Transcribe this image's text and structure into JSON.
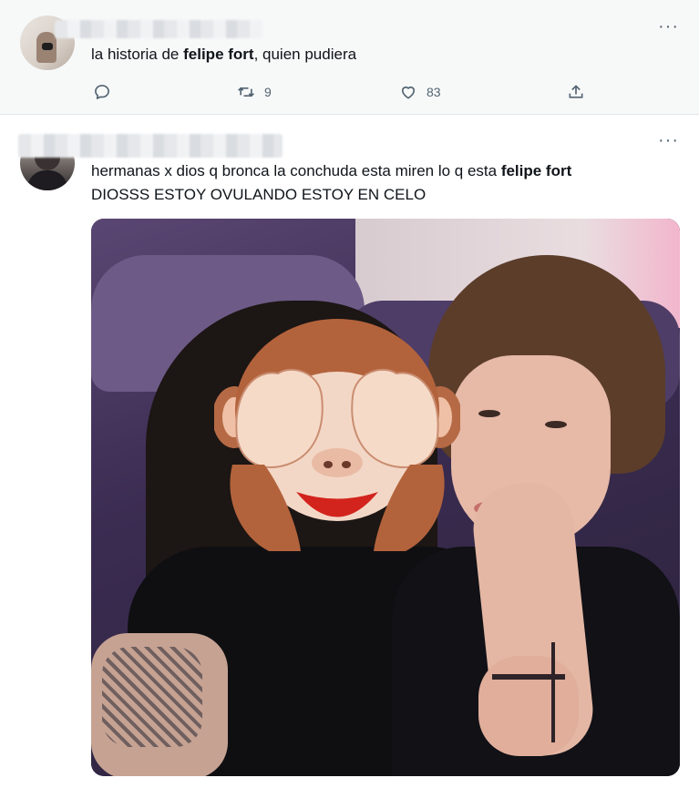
{
  "tweets": [
    {
      "text_prefix": "la historia de ",
      "text_bold": "felipe fort",
      "text_suffix": ", quien pudiera",
      "more_label": "···",
      "retweets": "9",
      "likes": "83"
    },
    {
      "line1_prefix": "hermanas x dios q bronca la conchuda esta miren lo q esta ",
      "line1_bold": "felipe fort",
      "line2": "DIOSSS ESTOY OVULANDO ESTOY EN CELO",
      "more_label": "···",
      "media_emoji": "see-no-evil-monkey"
    }
  ],
  "icons": {
    "reply": "reply-icon",
    "retweet": "retweet-icon",
    "like": "heart-icon",
    "share": "share-icon",
    "more": "more-icon"
  },
  "colors": {
    "icon_gray": "#536471",
    "text": "#0f1419",
    "first_tweet_bg": "#f7f9f9"
  }
}
